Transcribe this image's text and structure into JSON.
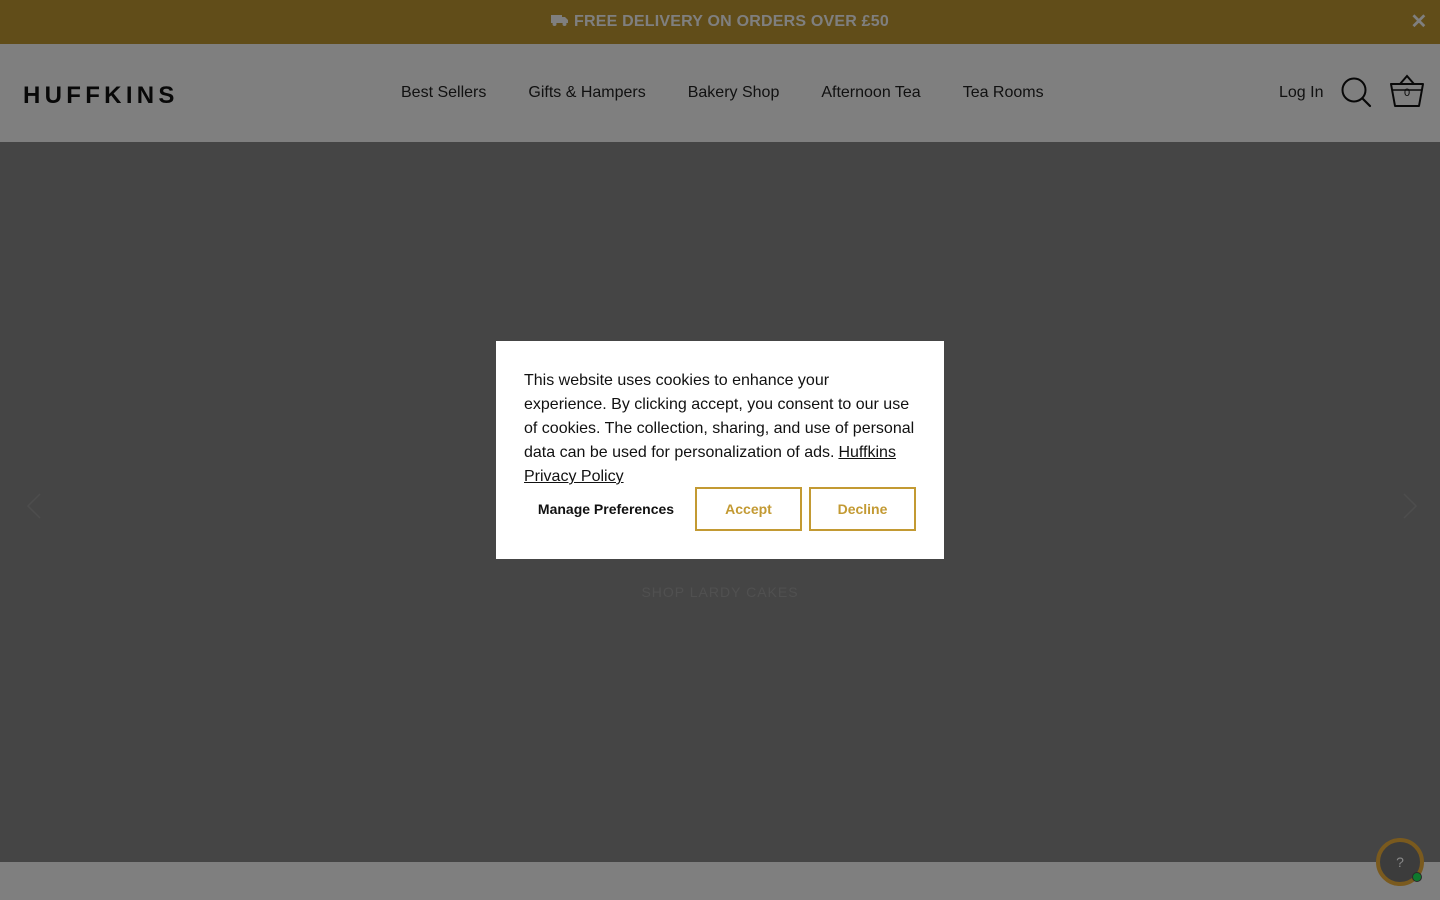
{
  "announcement": {
    "text": "FREE DELIVERY ON ORDERS OVER £50",
    "close_label": "✕"
  },
  "header": {
    "logo": "HUFFKINS",
    "nav": [
      {
        "label": "Best Sellers"
      },
      {
        "label": "Gifts & Hampers"
      },
      {
        "label": "Bakery Shop"
      },
      {
        "label": "Afternoon Tea"
      },
      {
        "label": "Tea Rooms"
      }
    ],
    "login_label": "Log In",
    "cart_count": "0"
  },
  "hero": {
    "cta": "SHOP LARDY CAKES"
  },
  "cookie_modal": {
    "message": "This website uses cookies to enhance your experience. By clicking accept, you consent to our use of cookies. The collection, sharing, and use of personal data can be used for personalization of ads.",
    "policy_link": "Huffkins Privacy Policy",
    "manage_label": "Manage Preferences",
    "accept_label": "Accept",
    "decline_label": "Decline"
  },
  "help": {
    "label": "?"
  },
  "colors": {
    "accent": "#c39a33",
    "overlay": "rgba(0,0,0,0.5)",
    "status_online": "#0e7a2d"
  }
}
